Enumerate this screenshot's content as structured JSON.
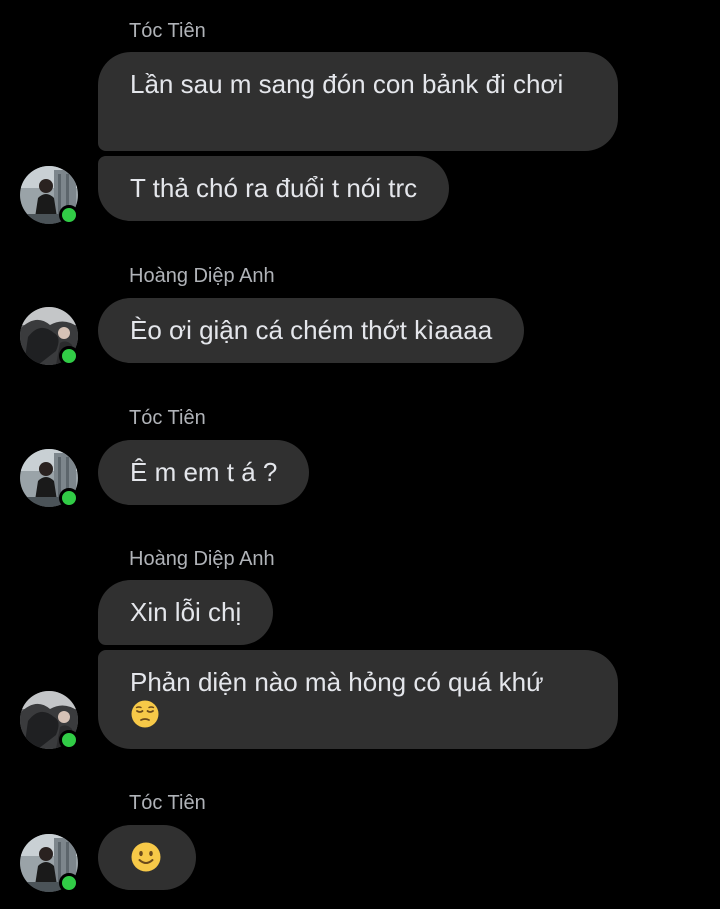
{
  "thread": {
    "groups": [
      {
        "sender": "Tóc Tiên",
        "messages": [
          "Lần sau m sang đón con bảnk đi chơi",
          "T thả chó ra đuổi t nói trc"
        ]
      },
      {
        "sender": "Hoàng Diệp Anh",
        "messages": [
          "Èo ơi giận cá chém thớt kìaaaa"
        ]
      },
      {
        "sender": "Tóc Tiên",
        "messages": [
          "Ê m em t á ?"
        ]
      },
      {
        "sender": "Hoàng Diệp Anh",
        "messages": [
          "Xin lỗi chị",
          "Phản diện nào mà hỏng có quá khứ"
        ],
        "emoji_after_last": "pensive-face-emoji"
      },
      {
        "sender": "Tóc Tiên",
        "emoji_message": "slightly-smiling-face-emoji"
      }
    ]
  },
  "colors": {
    "background": "#000000",
    "bubble": "#303030",
    "text": "#e4e6eb",
    "sender_name": "#b0b3b8",
    "online_dot": "#31cc46"
  }
}
